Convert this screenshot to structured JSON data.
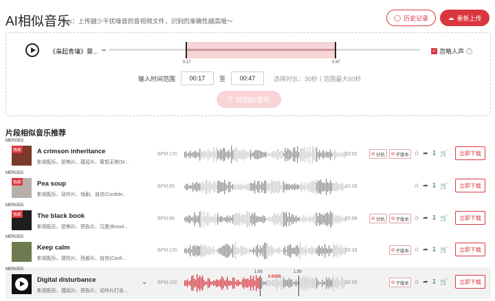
{
  "header": {
    "title": "AI相似音乐",
    "tips": "Tips：上传越少干扰噪音的音视频文件，识别的准确性越高哦～",
    "history_label": "历史记录",
    "reupload_label": "重新上传"
  },
  "player": {
    "song_name": "《枭起青壤》葵...",
    "start_mark": "0:17",
    "end_mark": "0:47",
    "ignore_vocals_label": "忽略人声",
    "help_icon": "?",
    "range_label": "输入时间范围",
    "start_value": "00:17",
    "to_label": "至",
    "end_value": "00:47",
    "selected_duration": "选择时长：30秒",
    "range_max": "范围最大60秒",
    "find_button": "找相似音乐"
  },
  "section_title": "片段相似音乐推荐",
  "tracks": [
    {
      "merged": "MERGED",
      "exclusive": "独家",
      "name": "A crimson inheritance",
      "tags": "影视配乐、恐怖片、蕴延片、寓怒无常(M...",
      "bpm": "BPM:120",
      "duration": "02:02",
      "badges": [
        "分轨",
        "子版本"
      ],
      "download": "立即下载",
      "thumb_color": "#7a3a2c"
    },
    {
      "merged": "MERGED",
      "exclusive": "独家",
      "name": "Pea soup",
      "tags": "影视配乐、动作片、戏剧、自信(Confide...",
      "bpm": "BPM:85",
      "duration": "01:26",
      "badges": [],
      "download": "立即下载",
      "thumb_color": "#b8b0a8"
    },
    {
      "merged": "MERGED",
      "exclusive": "独家",
      "name": "The black book",
      "tags": "影视配乐、恐怖片、预告片、沉思(Brood...",
      "bpm": "BPM:96",
      "duration": "02:06",
      "badges": [
        "分轨",
        "子版本"
      ],
      "download": "立即下载",
      "thumb_color": "#1e1e1e"
    },
    {
      "merged": "MERGED",
      "exclusive": "",
      "name": "Keep calm",
      "tags": "影视配乐、冒险片、西部片、自信(Confi...",
      "bpm": "BPM:135",
      "duration": "02:33",
      "badges": [
        "子版本"
      ],
      "download": "立即下载",
      "thumb_color": "#6e7a4e"
    },
    {
      "merged": "MERGED",
      "exclusive": "",
      "name": "Digital disturbance",
      "tags": "影视配乐、蕴延片、预告片、动作片打击...",
      "bpm": "BPM:100",
      "duration": "02:00",
      "badges": [
        "子版本"
      ],
      "download": "立即下载",
      "thumb_color": "#111111",
      "marker_start": "1:00",
      "marker_end": "1:30",
      "match_score": "0.9209"
    }
  ],
  "colors": {
    "accent": "#d9363e",
    "wave_dark": "#8c8c8c",
    "wave_light": "#cfcfcf",
    "wave_played": "#d9363e"
  },
  "icons": [
    "play-icon",
    "history-icon",
    "upload-icon",
    "search-icon",
    "star-icon",
    "share-icon",
    "download-icon",
    "cart-icon",
    "chevron-down-icon"
  ]
}
